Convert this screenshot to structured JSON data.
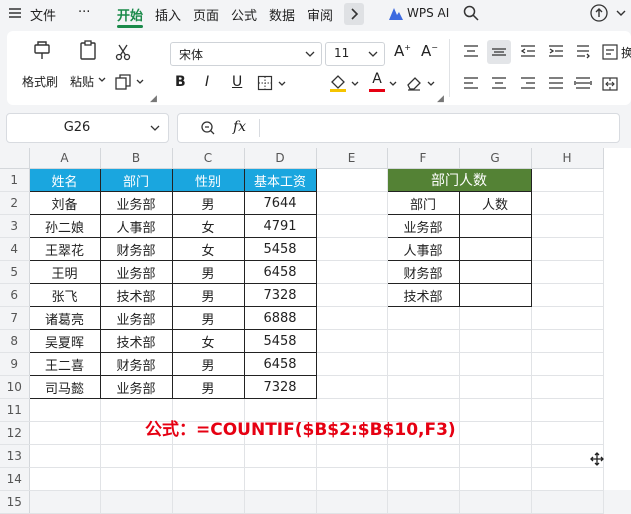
{
  "menubar": {
    "file_label": "文件",
    "more_label": "···",
    "tabs": [
      "开始",
      "插入",
      "页面",
      "公式",
      "数据",
      "审阅"
    ],
    "active_tab": "开始",
    "wps_ai_label": "WPS AI"
  },
  "ribbon": {
    "format_painter_label": "格式刷",
    "paste_label": "粘贴",
    "font_name": "宋体",
    "font_size": "11",
    "grow_font": "A",
    "shrink_font": "A",
    "bold": "B",
    "italic": "I",
    "underline": "U",
    "font_color": "A",
    "wrap_label": "换"
  },
  "formula_bar": {
    "cell_ref": "G26",
    "fx_label": "fx",
    "content": ""
  },
  "sheet": {
    "col_headers": [
      "A",
      "B",
      "C",
      "D",
      "E",
      "F",
      "G",
      "H"
    ],
    "row_numbers": [
      "1",
      "2",
      "3",
      "4",
      "5",
      "6",
      "7",
      "8",
      "9",
      "10",
      "11",
      "12",
      "13",
      "14",
      "15"
    ],
    "rows": [
      [
        "姓名",
        "部门",
        "性别",
        "基本工资",
        "",
        "部门人数",
        "",
        ""
      ],
      [
        "刘备",
        "业务部",
        "男",
        "7644",
        "",
        "部门",
        "人数",
        ""
      ],
      [
        "孙二娘",
        "人事部",
        "女",
        "4791",
        "",
        "业务部",
        "",
        ""
      ],
      [
        "王翠花",
        "财务部",
        "女",
        "5458",
        "",
        "人事部",
        "",
        ""
      ],
      [
        "王明",
        "业务部",
        "男",
        "6458",
        "",
        "财务部",
        "",
        ""
      ],
      [
        "张飞",
        "技术部",
        "男",
        "7328",
        "",
        "技术部",
        "",
        ""
      ],
      [
        "诸葛亮",
        "业务部",
        "男",
        "6888",
        "",
        "",
        "",
        ""
      ],
      [
        "吴夏晖",
        "技术部",
        "女",
        "5458",
        "",
        "",
        "",
        ""
      ],
      [
        "王二喜",
        "财务部",
        "男",
        "6458",
        "",
        "",
        "",
        ""
      ],
      [
        "司马懿",
        "业务部",
        "男",
        "7328",
        "",
        "",
        "",
        ""
      ],
      [
        "",
        "",
        "",
        "",
        "",
        "",
        "",
        ""
      ],
      [
        "",
        "",
        "",
        "",
        "",
        "",
        "",
        ""
      ],
      [
        "",
        "",
        "",
        "",
        "",
        "",
        "",
        ""
      ],
      [
        "",
        "",
        "",
        "",
        "",
        "",
        "",
        ""
      ],
      [
        "",
        "",
        "",
        "",
        "",
        "",
        "",
        ""
      ]
    ]
  },
  "annotation": {
    "formula_text": "公式：=COUNTIF($B$2:$B$10,F3)"
  },
  "colors": {
    "accent_green": "#1a8a4a",
    "header_blue": "#1aa6df",
    "header_green": "#548235",
    "formula_red": "#e60012"
  }
}
